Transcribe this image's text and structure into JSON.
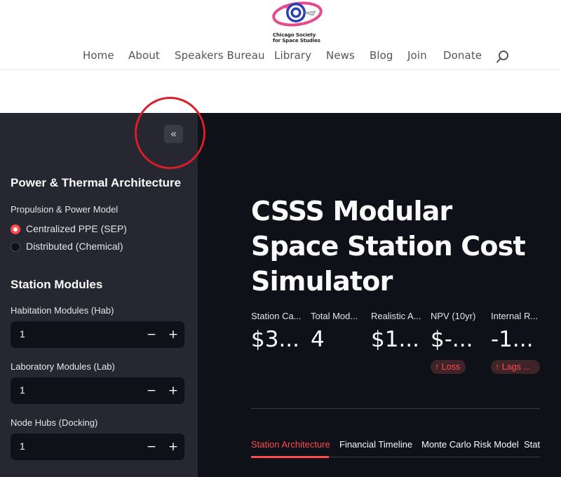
{
  "site": {
    "logo_line1": "Chicago Society",
    "logo_line2": "for Space Studies",
    "nav": [
      "Home",
      "About",
      "Speakers Bureau",
      "Library",
      "News",
      "Blog",
      "Join",
      "Donate"
    ]
  },
  "sidebar": {
    "collapse_label": "«",
    "power_heading": "Power & Thermal Architecture",
    "propulsion_label": "Propulsion & Power Model",
    "options": [
      "Centralized PPE (SEP)",
      "Distributed (Chemical)"
    ],
    "selected_option": "Centralized PPE (SEP)",
    "modules_heading": "Station Modules",
    "inputs": [
      {
        "label": "Habitation Modules (Hab)",
        "value": "1"
      },
      {
        "label": "Laboratory Modules (Lab)",
        "value": "1"
      },
      {
        "label": "Node Hubs (Docking)",
        "value": "1"
      }
    ],
    "minus": "−",
    "plus": "+"
  },
  "main": {
    "title": "CSSS Modular Space Station Cost Simulator",
    "metrics": [
      {
        "label": "Station Ca...",
        "value": "$3..."
      },
      {
        "label": "Total Mod...",
        "value": "4"
      },
      {
        "label": "Realistic A...",
        "value": "$1..."
      },
      {
        "label": "NPV (10yr)",
        "value": "$-..."
      },
      {
        "label": "Internal R...",
        "value": "-1..."
      }
    ],
    "deltas": [
      "↑ Loss",
      "↑ Lags ..."
    ],
    "tabs": [
      "Station Architecture",
      "Financial Timeline",
      "Monte Carlo Risk Model",
      "Stat"
    ],
    "active_tab": "Station Architecture"
  },
  "colors": {
    "accent": "#ff4b4b",
    "app_bg": "#0e1117",
    "sidebar_bg": "#262730",
    "annotation": "#d81e2a"
  }
}
